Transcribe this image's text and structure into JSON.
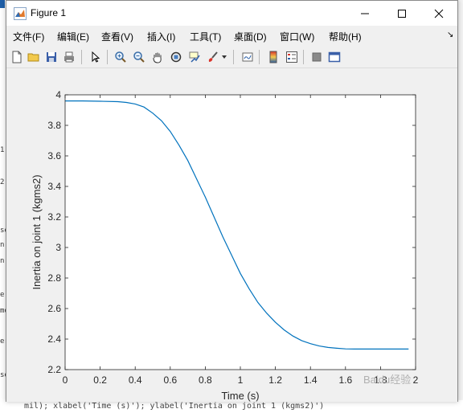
{
  "window": {
    "title": "Figure 1"
  },
  "menu": {
    "items": [
      {
        "label": "文件(F)"
      },
      {
        "label": "编辑(E)"
      },
      {
        "label": "查看(V)"
      },
      {
        "label": "插入(I)"
      },
      {
        "label": "工具(T)"
      },
      {
        "label": "桌面(D)"
      },
      {
        "label": "窗口(W)"
      },
      {
        "label": "帮助(H)"
      }
    ]
  },
  "toolbar": {
    "buttons": [
      "new-figure-icon",
      "open-file-icon",
      "save-icon",
      "print-icon",
      "pointer-icon",
      "zoom-in-icon",
      "zoom-out-icon",
      "pan-hand-icon",
      "rotate-3d-icon",
      "data-cursor-icon",
      "brush-icon",
      "link-icon",
      "colorbar-icon",
      "legend-icon",
      "hide-plot-tools-icon",
      "show-plot-tools-icon"
    ]
  },
  "background": {
    "code_line": "mil); xlabel('Time (s)'); ylabel('Inertia on joint 1 (kgms2)')",
    "left_fragments": [
      "1",
      "2",
      "se",
      "n.",
      "n",
      "e",
      "mo",
      "er",
      "se"
    ]
  },
  "watermark": "Baidu经验",
  "chart_data": {
    "type": "line",
    "title": "",
    "xlabel": "Time (s)",
    "ylabel": "Inertia on joint 1 (kgms2)",
    "xlim": [
      0,
      2
    ],
    "ylim": [
      2.2,
      4
    ],
    "xticks": [
      "0",
      "0.2",
      "0.4",
      "0.6",
      "0.8",
      "1",
      "1.2",
      "1.4",
      "1.6",
      "1.8",
      "2"
    ],
    "yticks": [
      "2.2",
      "2.4",
      "2.6",
      "2.8",
      "3",
      "3.2",
      "3.4",
      "3.6",
      "3.8",
      "4"
    ],
    "grid": false,
    "line_color": "#0072bd",
    "series": [
      {
        "x": [
          0,
          0.1,
          0.2,
          0.3,
          0.35,
          0.4,
          0.45,
          0.5,
          0.55,
          0.6,
          0.65,
          0.7,
          0.75,
          0.8,
          0.85,
          0.9,
          0.95,
          1.0,
          1.05,
          1.1,
          1.15,
          1.2,
          1.25,
          1.3,
          1.35,
          1.4,
          1.45,
          1.5,
          1.55,
          1.6,
          1.65,
          1.7,
          1.8,
          1.9,
          1.96
        ],
        "values": [
          3.96,
          3.96,
          3.958,
          3.955,
          3.95,
          3.94,
          3.92,
          3.88,
          3.83,
          3.76,
          3.67,
          3.57,
          3.45,
          3.33,
          3.2,
          3.07,
          2.95,
          2.83,
          2.73,
          2.64,
          2.57,
          2.51,
          2.46,
          2.42,
          2.39,
          2.37,
          2.355,
          2.345,
          2.34,
          2.336,
          2.335,
          2.335,
          2.335,
          2.335,
          2.335
        ]
      }
    ]
  }
}
